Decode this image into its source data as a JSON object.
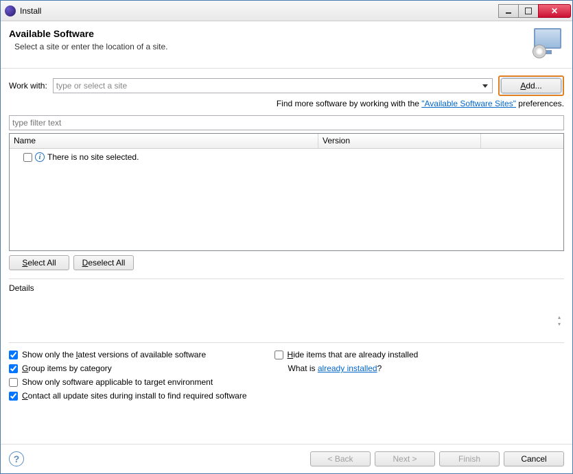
{
  "window": {
    "title": "Install"
  },
  "header": {
    "title": "Available Software",
    "subtitle": "Select a site or enter the location of a site."
  },
  "workwith": {
    "label": "Work with:",
    "placeholder": "type or select a site",
    "add": "Add..."
  },
  "findline": {
    "prefix": "Find more software by working with the ",
    "link": "\"Available Software Sites\"",
    "suffix": " preferences."
  },
  "filter": {
    "placeholder": "type filter text"
  },
  "table": {
    "col_name": "Name",
    "col_version": "Version",
    "empty_msg": "There is no site selected."
  },
  "buttons": {
    "select_all": "Select All",
    "deselect_all": "Deselect All"
  },
  "details": {
    "label": "Details"
  },
  "options": {
    "latest": {
      "pre": "Show only the ",
      "u": "l",
      "post": "atest versions of available software",
      "checked": true
    },
    "group": {
      "pre": "",
      "u": "G",
      "post": "roup items by category",
      "checked": true
    },
    "target": {
      "pre": "Show only software applicable to target environment",
      "checked": false
    },
    "contact": {
      "pre": "",
      "u": "C",
      "post": "ontact all update sites during install to find required software",
      "checked": true
    },
    "hide": {
      "pre": "",
      "u": "H",
      "post": "ide items that are already installed",
      "checked": false
    },
    "whatis_pre": "What is ",
    "whatis_link": "already installed",
    "whatis_post": "?"
  },
  "footer": {
    "back": "< Back",
    "next": "Next >",
    "finish": "Finish",
    "cancel": "Cancel"
  }
}
